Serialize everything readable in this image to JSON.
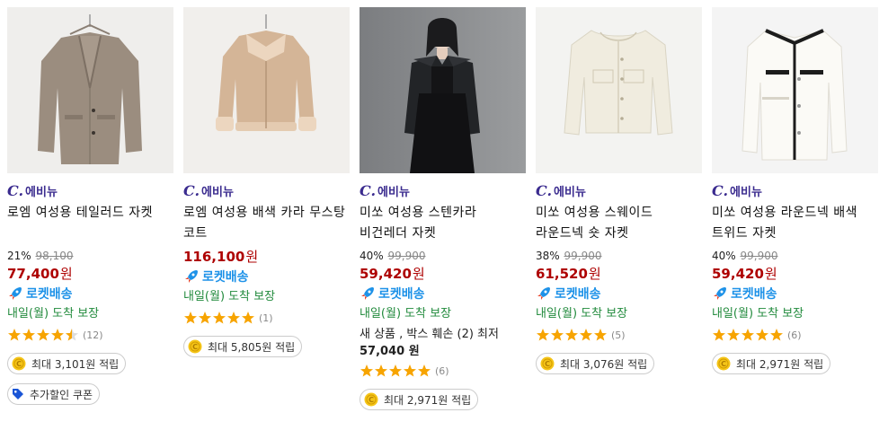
{
  "colors": {
    "brand": "#3b2c8f",
    "price": "#ae0000",
    "rocket": "#1e92e8",
    "arrival": "#218a3c",
    "star": "#f7a400"
  },
  "products": [
    {
      "brand": "에비뉴",
      "brand_c": "C.",
      "title": "로엠 여성용 테일러드 자켓",
      "discount": "21%",
      "original_price": "98,100",
      "price": "77,400",
      "currency": "원",
      "rocket": "로켓배송",
      "arrival": "내일(월) 도착 보장",
      "rating": 4.5,
      "review_count": "(12)",
      "reward": "최대 3,101원 적립",
      "coupon": "추가할인 쿠폰"
    },
    {
      "brand": "에비뉴",
      "brand_c": "C.",
      "title": "로엠 여성용 배색 카라 무스탕 코트",
      "price": "116,100",
      "currency": "원",
      "rocket": "로켓배송",
      "arrival": "내일(월) 도착 보장",
      "rating": 5,
      "review_count": "(1)",
      "reward": "최대 5,805원 적립"
    },
    {
      "brand": "에비뉴",
      "brand_c": "C.",
      "title": "미쏘 여성용 스텐카라 비건레더 자켓",
      "discount": "40%",
      "original_price": "99,900",
      "price": "59,420",
      "currency": "원",
      "rocket": "로켓배송",
      "arrival": "내일(월) 도착 보장",
      "extra_line": "새 상품 , 박스 훼손 (2) 최저",
      "extra_price": "57,040 원",
      "rating": 5,
      "review_count": "(6)",
      "reward": "최대 2,971원 적립"
    },
    {
      "brand": "에비뉴",
      "brand_c": "C.",
      "title": "미쏘 여성용 스웨이드 라운드넥 숏 자켓",
      "discount": "38%",
      "original_price": "99,900",
      "price": "61,520",
      "currency": "원",
      "rocket": "로켓배송",
      "arrival": "내일(월) 도착 보장",
      "rating": 5,
      "review_count": "(5)",
      "reward": "최대 3,076원 적립"
    },
    {
      "brand": "에비뉴",
      "brand_c": "C.",
      "title": "미쏘 여성용 라운드넥 배색 트위드 자켓",
      "discount": "40%",
      "original_price": "99,900",
      "price": "59,420",
      "currency": "원",
      "rocket": "로켓배송",
      "arrival": "내일(월) 도착 보장",
      "rating": 5,
      "review_count": "(6)",
      "reward": "최대 2,971원 적립"
    }
  ]
}
